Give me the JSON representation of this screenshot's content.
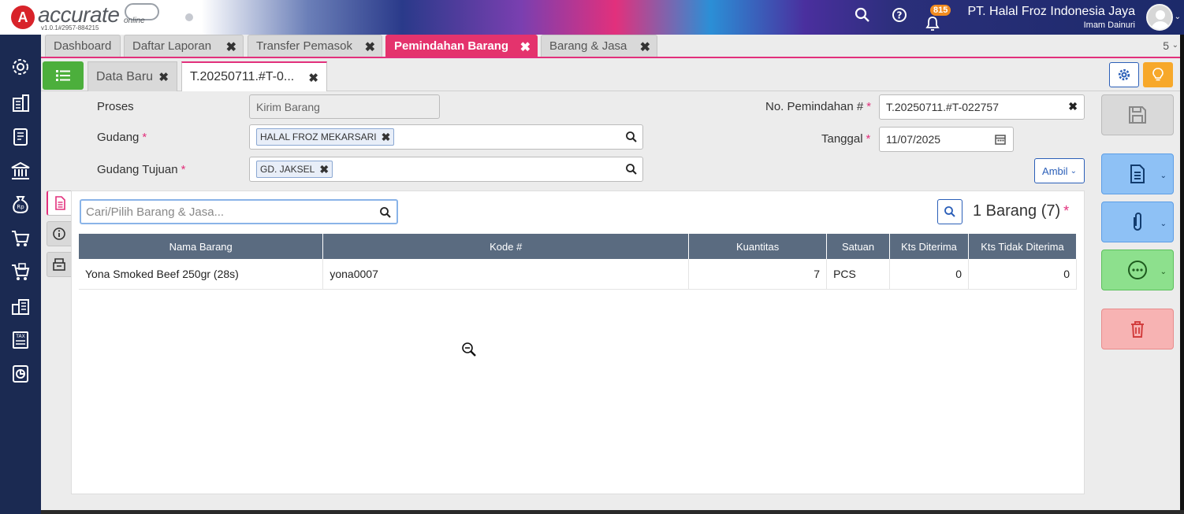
{
  "app": {
    "logo_text": "accurate",
    "logo_sub": "online",
    "version": "v1.0.1#2957-884215"
  },
  "header": {
    "notification_count": "815",
    "company_name": "PT. Halal Froz Indonesia Jaya",
    "user_name": "Imam Dainuri"
  },
  "tabs": [
    {
      "label": "Dashboard"
    },
    {
      "label": "Daftar Laporan"
    },
    {
      "label": "Transfer Pemasok"
    },
    {
      "label": "Pemindahan Barang"
    },
    {
      "label": "Barang & Jasa"
    }
  ],
  "tab_count": "5",
  "subtabs": [
    {
      "label": "Data Baru"
    },
    {
      "label": "T.20250711.#T-0..."
    }
  ],
  "form": {
    "proses_label": "Proses",
    "proses_value": "Kirim Barang",
    "gudang_label": "Gudang",
    "gudang_value": "HALAL FROZ MEKARSARI",
    "gudang_tujuan_label": "Gudang Tujuan",
    "gudang_tujuan_value": "GD. JAKSEL",
    "no_label": "No. Pemindahan #",
    "no_value": "T.20250711.#T-022757",
    "tanggal_label": "Tanggal",
    "tanggal_value": "11/07/2025",
    "ambil_label": "Ambil",
    "required_mark": "*"
  },
  "detail": {
    "search_placeholder": "Cari/Pilih Barang & Jasa...",
    "item_count": "1 Barang (7)",
    "columns": [
      "Nama Barang",
      "Kode #",
      "Kuantitas",
      "Satuan",
      "Kts Diterima",
      "Kts Tidak Diterima"
    ],
    "rows": [
      {
        "nama": "Yona Smoked Beef 250gr (28s)",
        "kode": "yona0007",
        "kuantitas": "7",
        "satuan": "PCS",
        "diterima": "0",
        "tidak_diterima": "0"
      }
    ]
  },
  "colors": {
    "accent": "#e4336d",
    "sidebar": "#1b2a52",
    "primary_blue": "#2b5fb8",
    "table_header": "#5a6b80"
  }
}
